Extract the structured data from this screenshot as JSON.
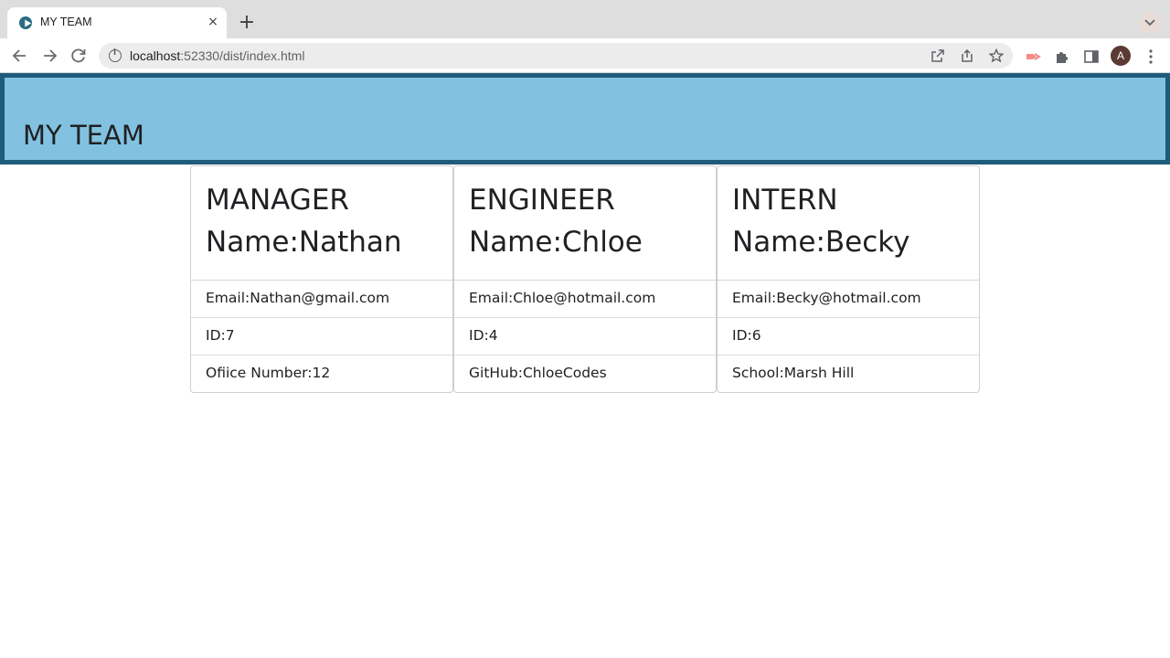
{
  "browser": {
    "tab_title": "MY TEAM",
    "tab_close": "×",
    "new_tab": "+",
    "url_host": "localhost",
    "url_rest": ":52330/dist/index.html",
    "profile_initial": "A"
  },
  "page": {
    "title": "MY TEAM"
  },
  "cards": [
    {
      "role": "MANAGER",
      "name_label": "Name:",
      "name": "Nathan",
      "email_label": "Email:",
      "email": "Nathan@gmail.com",
      "id_label": "ID:",
      "id": "7",
      "extra_label": "Ofiice Number:",
      "extra": "12"
    },
    {
      "role": "ENGINEER",
      "name_label": "Name:",
      "name": "Chloe",
      "email_label": "Email:",
      "email": "Chloe@hotmail.com",
      "id_label": "ID:",
      "id": "4",
      "extra_label": "GitHub:",
      "extra": "ChloeCodes"
    },
    {
      "role": "INTERN",
      "name_label": "Name:",
      "name": "Becky",
      "email_label": "Email:",
      "email": "Becky@hotmail.com",
      "id_label": "ID:",
      "id": "6",
      "extra_label": "School:",
      "extra": "Marsh Hill"
    }
  ],
  "colors": {
    "header_bg": "#82c2e0",
    "header_border": "#1f5b7c"
  }
}
